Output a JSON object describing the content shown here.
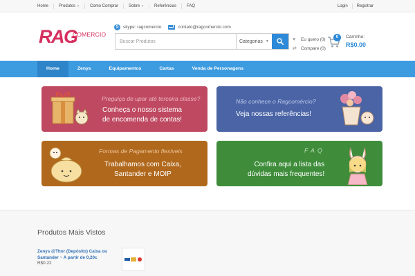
{
  "topbar": {
    "nav": [
      {
        "label": "Home"
      },
      {
        "label": "Produtos",
        "has_dropdown": true
      },
      {
        "label": "Como Comprar"
      },
      {
        "label": "Sobre",
        "has_dropdown": true
      },
      {
        "label": "Referências"
      },
      {
        "label": "FAQ"
      }
    ],
    "login": "Login",
    "register": "Registrar"
  },
  "header": {
    "logo_main": "RAG",
    "logo_sub": "COMERCIO",
    "skype": "skype: ragcomercio",
    "email": "contato@ragcomercio.com",
    "search_placeholder": "Buscar Produtos",
    "category_label": "Categorias",
    "wishlist": "Eu quero (0)",
    "compare": "Compare (0)",
    "cart_label": "Carrinho:",
    "cart_total": "R$0.00",
    "cart_count": "0"
  },
  "mainnav": {
    "items": [
      {
        "label": "Home"
      },
      {
        "label": "Zenys"
      },
      {
        "label": "Equipamentos"
      },
      {
        "label": "Cartas"
      },
      {
        "label": "Venda de Personagens"
      }
    ]
  },
  "banners": [
    {
      "subtitle": "Preguiça de upar até terceira classe?",
      "line1": "Conheça o nosso sistema",
      "line2": "de encomenda de contas!"
    },
    {
      "subtitle": "Não conhece o Ragcomércio?",
      "line1": "Veja nossas referências!"
    },
    {
      "subtitle": "Formas de Pagamento flexíveis",
      "line1": "Trabalhamos com Caixa,",
      "line2": "Santander e MOIP"
    },
    {
      "subtitle": "F A Q",
      "line1": "Confira aqui a lista das",
      "line2": "dúvidas mais frequentes!"
    }
  ],
  "most_viewed": {
    "title": "Produtos Mais Vistos",
    "products": [
      {
        "name": "Zenys @Thor (Depósito) Caixa ou Santander ~ A partir de 0,20c",
        "price": "R$0.22"
      }
    ]
  },
  "colors": {
    "accent": "#3d9be0",
    "brand": "#d6305f",
    "banner_pink": "#bf4961",
    "banner_blue": "#4a64a6",
    "banner_orange": "#b0681d",
    "banner_green": "#3f8d3b"
  }
}
